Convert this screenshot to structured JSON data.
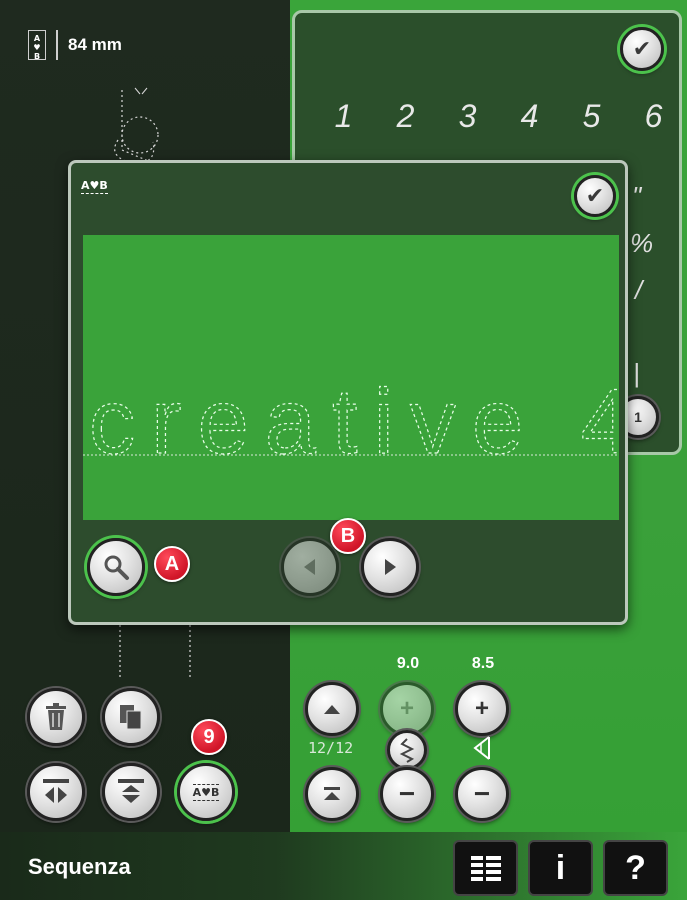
{
  "status": {
    "length_value": "84 mm",
    "abc_icon": "abc-sequence-icon"
  },
  "char_panel": {
    "digits": [
      "1",
      "2",
      "3",
      "4",
      "5",
      "6"
    ],
    "confirm_icon": "check-icon"
  },
  "dialog": {
    "abc_label": "A♥B",
    "confirm_icon": "check-icon",
    "preview_text": "creative 4",
    "zoom_icon": "magnifier-icon",
    "prev_icon": "arrow-left-icon",
    "next_icon": "arrow-right-icon"
  },
  "callouts": {
    "a": "A",
    "b": "B",
    "nine": "9"
  },
  "controls": {
    "width_value": "9.0",
    "length_value": "8.5",
    "counter": "12/12",
    "abc_btn_label": "A♥B"
  },
  "bottom": {
    "title": "Sequenza",
    "menu_icon": "list-icon",
    "info_label": "i",
    "help_label": "?"
  },
  "colors": {
    "accent_green": "#3aa53a",
    "dark_panel": "#1f2a1f",
    "callout_red": "#d01528"
  }
}
